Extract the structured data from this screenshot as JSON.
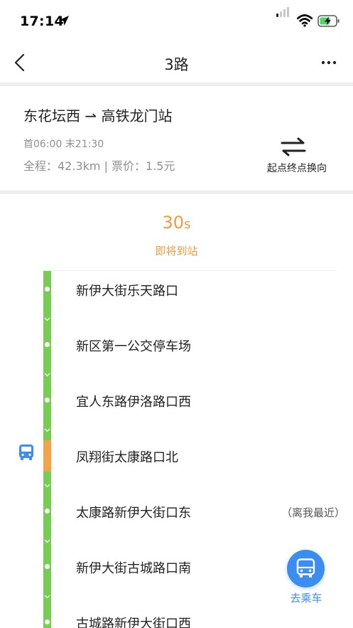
{
  "status_bar": {
    "time": "17:14"
  },
  "nav": {
    "title": "3路"
  },
  "route": {
    "name": "东花坛西 ⇀ 高铁龙门站",
    "time": "首06:00 末21:30",
    "meta": "全程：42.3km | 票价：1.5元",
    "reverse_label": "起点终点换向"
  },
  "arrival": {
    "seconds": "30",
    "unit": "s",
    "status": "即将到站"
  },
  "stops": [
    {
      "name": "新伊大街乐天路口"
    },
    {
      "name": "新区第一公交停车场"
    },
    {
      "name": "宜人东路伊洛路口西"
    },
    {
      "name": "凤翔街太康路口北"
    },
    {
      "name": "太康路新伊大街口东"
    },
    {
      "name": "新伊大街古城路口南"
    },
    {
      "name": "古城路新伊大街口西"
    }
  ],
  "nearest_tag": "（离我最近）",
  "take_bus": {
    "label": "去乘车"
  },
  "colors": {
    "accent_orange": "#f19a3e",
    "track_green": "#78cc53",
    "bus_blue": "#3b8ef0"
  },
  "icons": {
    "back": "chevron-left-icon",
    "more": "more-icon",
    "reverse": "swap-arrows-icon",
    "bus": "bus-icon"
  }
}
